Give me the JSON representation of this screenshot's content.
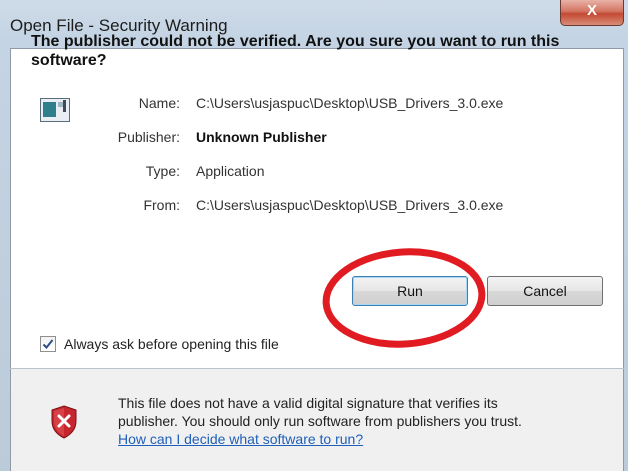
{
  "window": {
    "title": "Open File - Security Warning",
    "close_glyph": "X"
  },
  "dialog": {
    "heading": "The publisher could not be verified.  Are you sure you want to run this software?",
    "fields": {
      "name_label": "Name:",
      "name_value": "C:\\Users\\usjaspuc\\Desktop\\USB_Drivers_3.0.exe",
      "publisher_label": "Publisher:",
      "publisher_value": "Unknown Publisher",
      "type_label": "Type:",
      "type_value": "Application",
      "from_label": "From:",
      "from_value": "C:\\Users\\usjaspuc\\Desktop\\USB_Drivers_3.0.exe"
    },
    "buttons": {
      "run_label": "Run",
      "cancel_label": "Cancel"
    },
    "checkbox": {
      "label": "Always ask before opening this file",
      "checked": true
    }
  },
  "footer": {
    "text_line1": "This file does not have a valid digital signature that verifies its",
    "text_line2": "publisher.  You should only run software from publishers you trust.",
    "link_text": "How can I decide what software to run?"
  },
  "colors": {
    "annotation_circle": "#e01b22",
    "link": "#1f5fb8"
  },
  "icons": {
    "app": "application-icon",
    "shield": "security-shield-x-icon",
    "check": "checkmark-icon",
    "close": "close-icon"
  }
}
